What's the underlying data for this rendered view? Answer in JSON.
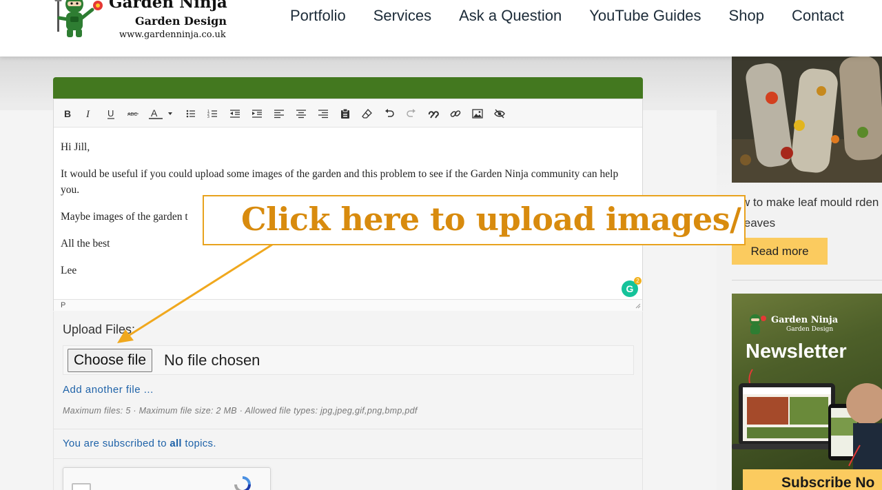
{
  "header": {
    "logo_title": "Garden Ninja",
    "logo_subtitle": "Garden Design",
    "logo_url": "www.gardenninja.co.uk",
    "nav": [
      "Portfolio",
      "Services",
      "Ask a Question",
      "YouTube Guides",
      "Shop",
      "Contact"
    ]
  },
  "editor": {
    "toolbar_icons": [
      "bold-icon",
      "italic-icon",
      "underline-icon",
      "strikethrough-icon",
      "text-color-icon",
      "bullet-list-icon",
      "numbered-list-icon",
      "outdent-icon",
      "indent-icon",
      "align-left-icon",
      "align-center-icon",
      "align-right-icon",
      "paste-icon",
      "eraser-icon",
      "undo-icon",
      "redo-icon",
      "blockquote-icon",
      "link-icon",
      "image-icon",
      "preview-icon"
    ],
    "paragraphs": [
      "Hi Jill,",
      "It would be useful if you could upload some images of the garden and this problem to see if the Garden Ninja community can help you.",
      "Maybe images of the garden t",
      "All the best",
      "Lee"
    ],
    "status_path": "P",
    "grammarly_letter": "G",
    "grammarly_count": "2"
  },
  "upload": {
    "label": "Upload Files:",
    "choose_button": "Choose file",
    "no_file_text": "No file chosen",
    "add_another": "Add another file ...",
    "limits": "Maximum files: 5 · Maximum file size: 2 MB · Allowed file types: jpg,jpeg,gif,png,bmp,pdf"
  },
  "subscription": {
    "prefix": "You are subscribed to ",
    "emphasis": "all",
    "suffix": " topics."
  },
  "annotation": {
    "text": "Click here to upload images/",
    "color": "#d88b0e",
    "border_color": "#e8a21d"
  },
  "sidebar": {
    "article_caption": "w to make leaf mould rden leaves",
    "read_more": "Read more",
    "ad_logo_title": "Garden Ninja",
    "ad_logo_subtitle": "Garden Design",
    "ad_headline": "Newsletter",
    "ad_cta": "Subscribe No"
  },
  "colors": {
    "brand_green": "#43781f",
    "link_blue": "#1e62a8",
    "cta_yellow": "#fbcb5f"
  }
}
